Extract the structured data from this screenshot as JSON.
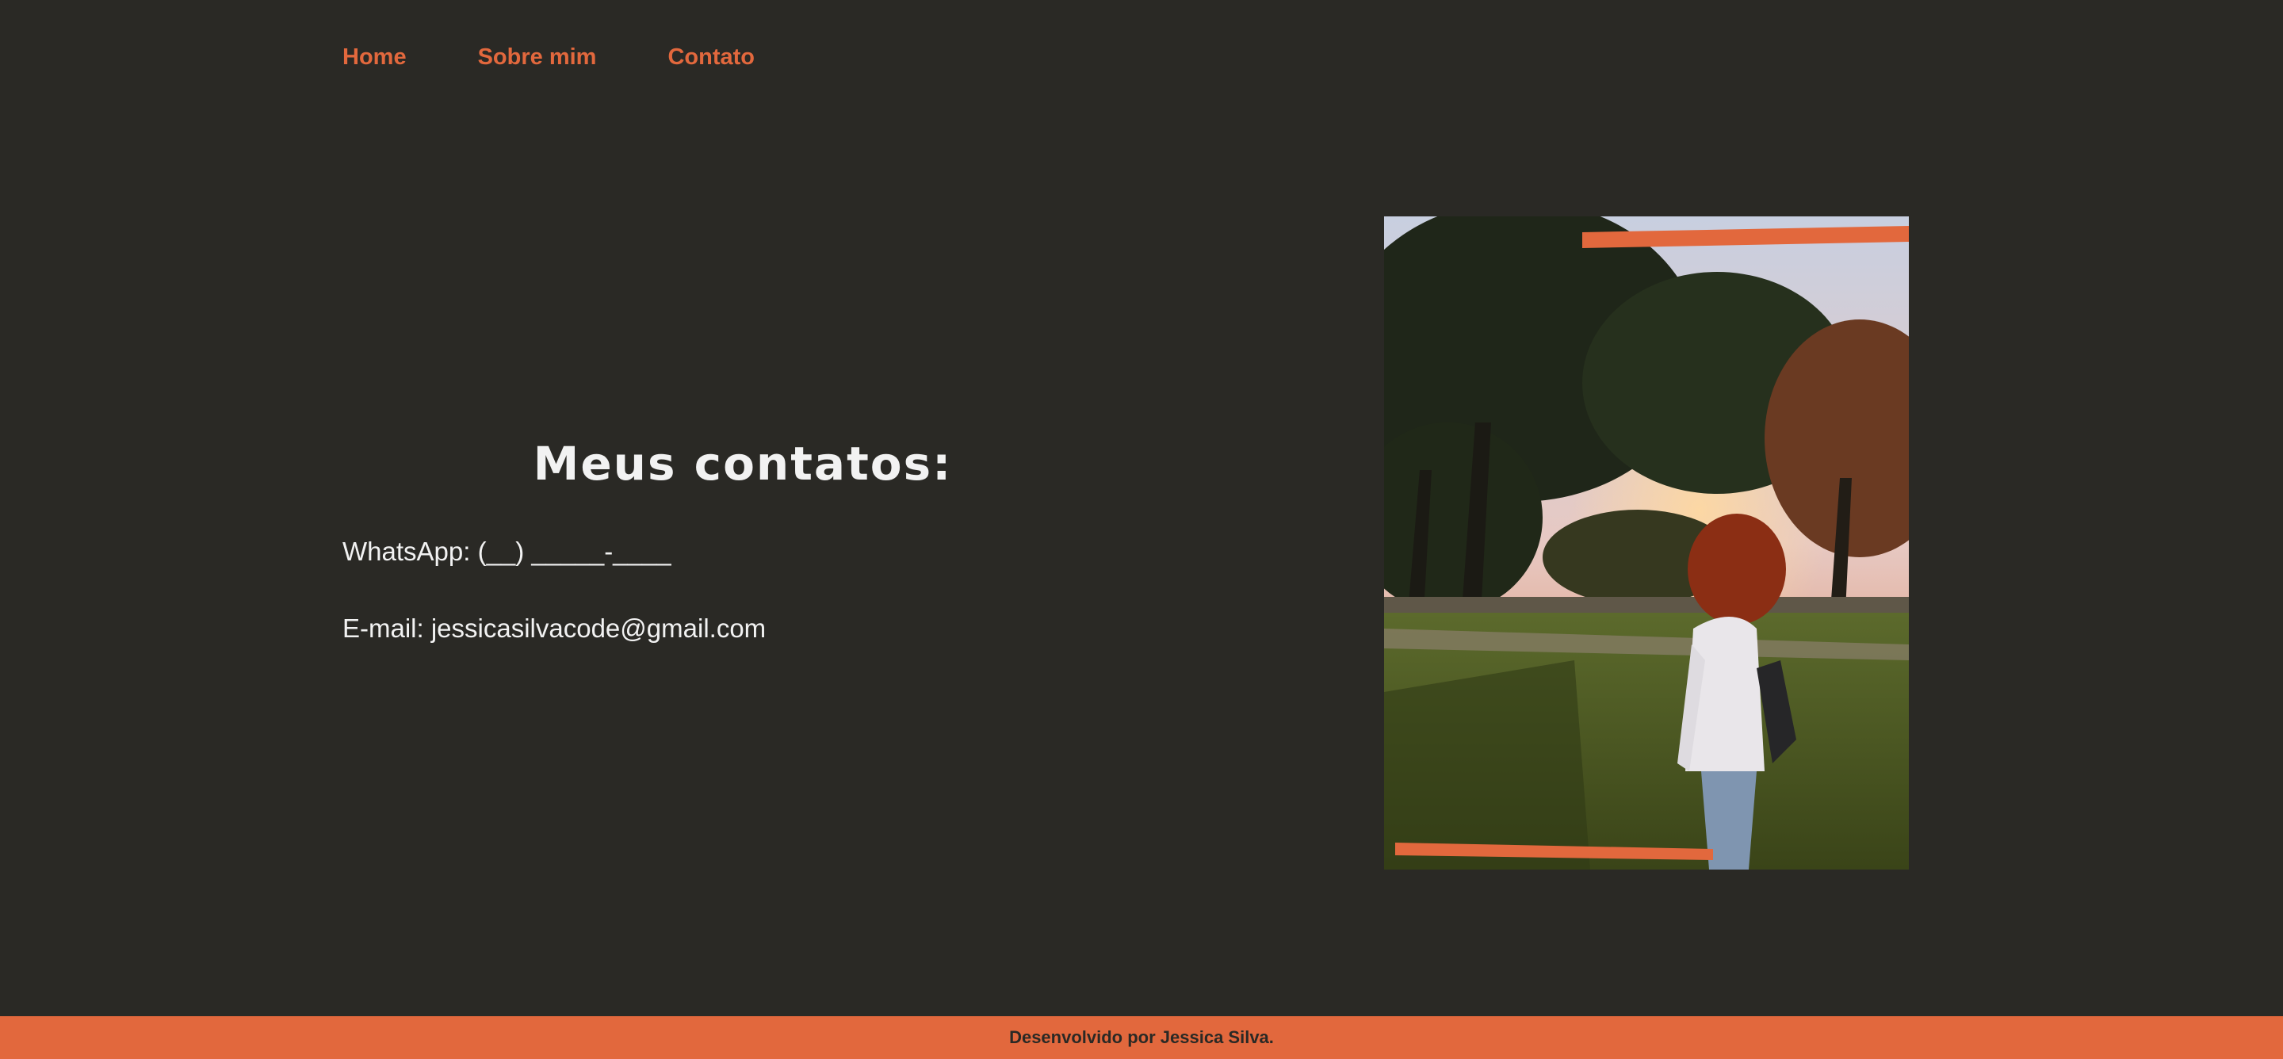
{
  "nav": {
    "items": [
      {
        "label": "Home"
      },
      {
        "label": "Sobre mim"
      },
      {
        "label": "Contato"
      }
    ]
  },
  "main": {
    "title": "Meus contatos:",
    "whatsapp": "WhatsApp: (__) _____-____",
    "email": "E-mail: jessicasilvacode@gmail.com"
  },
  "footer": {
    "text": "Desenvolvido por Jessica Silva."
  },
  "colors": {
    "background": "#2a2925",
    "accent": "#e2683d",
    "text": "#f2f2f2"
  }
}
